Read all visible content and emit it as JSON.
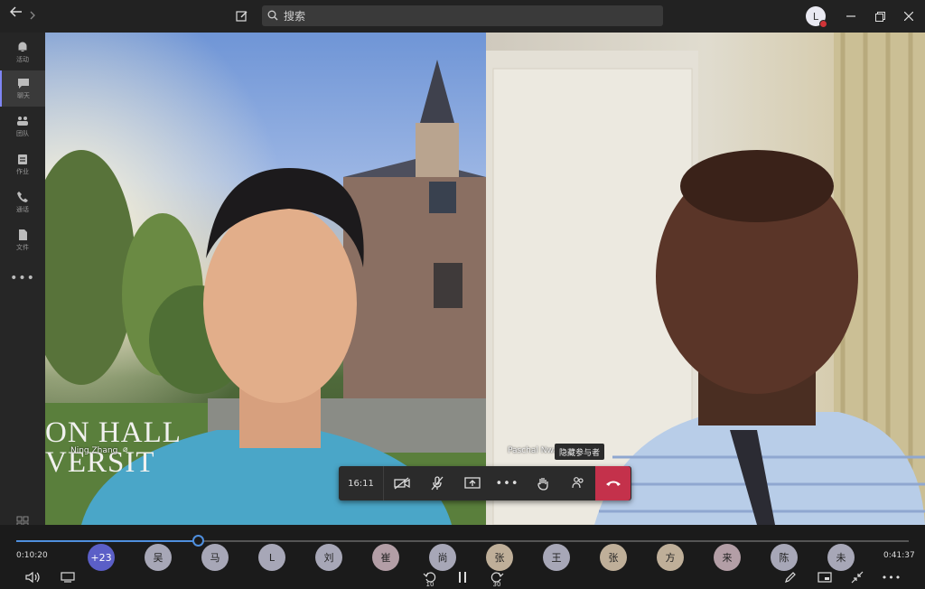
{
  "titlebar": {
    "search_placeholder": "搜索",
    "user_initial": "L"
  },
  "rail": {
    "items": [
      {
        "label": "活动",
        "icon": "bell-icon"
      },
      {
        "label": "聊天",
        "icon": "chat-icon"
      },
      {
        "label": "团队",
        "icon": "teams-icon"
      },
      {
        "label": "作业",
        "icon": "assignments-icon"
      },
      {
        "label": "通话",
        "icon": "phone-icon"
      },
      {
        "label": "文件",
        "icon": "file-icon"
      }
    ],
    "active_index": 1
  },
  "video": {
    "left_name": "Ning Zhang",
    "right_name": "Paschal Nwak",
    "banner_text_1": "ON HALL",
    "banner_text_2": "VERSIT"
  },
  "controls": {
    "timer": "16:11",
    "tooltip": "隐藏参与者"
  },
  "player": {
    "elapsed": "0:10:20",
    "duration": "0:41:37",
    "progress": 0.204,
    "rewind_seconds": "10",
    "forward_seconds": "30"
  },
  "participants": [
    {
      "label": "+23",
      "color": "#5b5fc7",
      "text_color": "#ffffff"
    },
    {
      "label": "吴",
      "color": "#a7a7b7"
    },
    {
      "label": "马",
      "color": "#a7a7b7"
    },
    {
      "label": "L",
      "color": "#a7a7b7"
    },
    {
      "label": "刘",
      "color": "#a7a7b7"
    },
    {
      "label": "崔",
      "color": "#b39ea6"
    },
    {
      "label": "尚",
      "color": "#a7a7b7"
    },
    {
      "label": "张",
      "color": "#bfaf99"
    },
    {
      "label": "王",
      "color": "#a7a7b7"
    },
    {
      "label": "张",
      "color": "#bfaf99"
    },
    {
      "label": "方",
      "color": "#bfaf99"
    },
    {
      "label": "来",
      "color": "#b39ea6"
    },
    {
      "label": "陈",
      "color": "#a7a7b7"
    },
    {
      "label": "未",
      "color": "#a7a7b7"
    }
  ]
}
